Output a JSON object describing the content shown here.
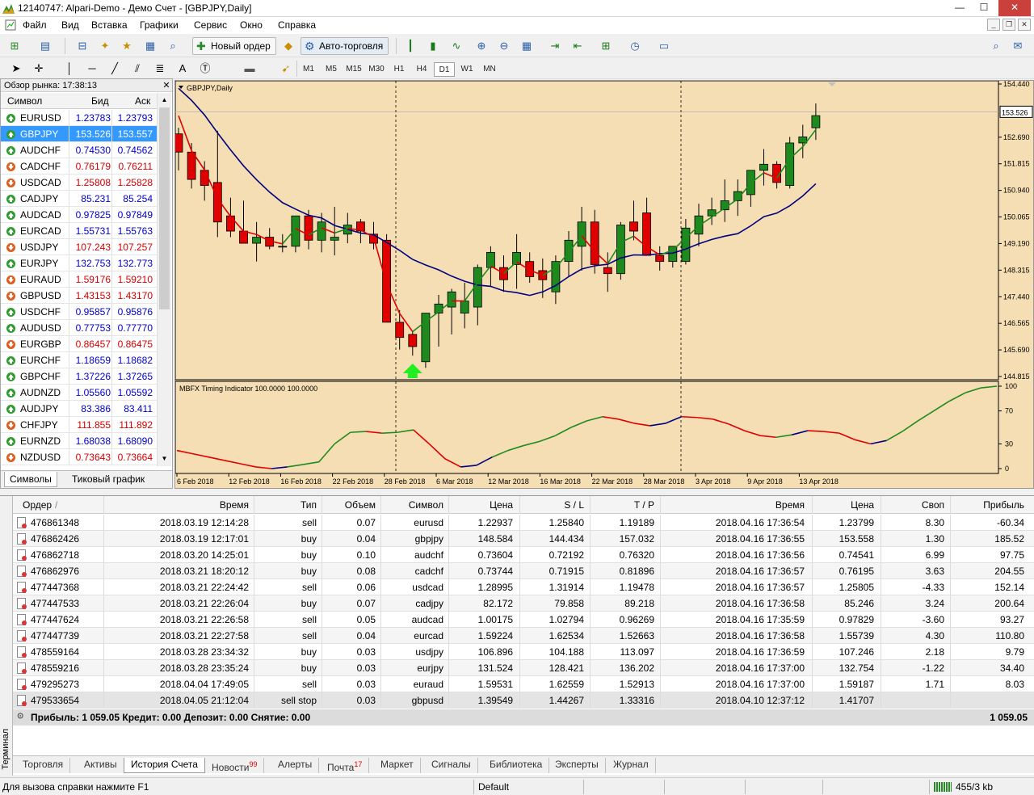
{
  "window": {
    "title": "12140747: Alpari-Demo - Демо Счет - [GBPJPY,Daily]",
    "min": "—",
    "max": "☐",
    "close": "✕"
  },
  "menu": [
    "Файл",
    "Вид",
    "Вставка",
    "Графики",
    "Сервис",
    "Окно",
    "Справка"
  ],
  "toolbar": {
    "new_order": "Новый ордер",
    "auto_trading": "Авто-торговля"
  },
  "timeframes": [
    "M1",
    "M5",
    "M15",
    "M30",
    "H1",
    "H4",
    "D1",
    "W1",
    "MN"
  ],
  "market_watch": {
    "title": "Обзор рынка: 17:38:13",
    "col_symbol": "Символ",
    "col_bid": "Бид",
    "col_ask": "Аск",
    "rows": [
      {
        "sym": "EURUSD",
        "bid": "1.23783",
        "ask": "1.23793",
        "dir": "up",
        "color": "#0000c8"
      },
      {
        "sym": "GBPJPY",
        "bid": "153.526",
        "ask": "153.557",
        "dir": "up",
        "color": "#ffffff"
      },
      {
        "sym": "AUDCHF",
        "bid": "0.74530",
        "ask": "0.74562",
        "dir": "up",
        "color": "#0000c8"
      },
      {
        "sym": "CADCHF",
        "bid": "0.76179",
        "ask": "0.76211",
        "dir": "down",
        "color": "#d40000"
      },
      {
        "sym": "USDCAD",
        "bid": "1.25808",
        "ask": "1.25828",
        "dir": "down",
        "color": "#d40000"
      },
      {
        "sym": "CADJPY",
        "bid": "85.231",
        "ask": "85.254",
        "dir": "up",
        "color": "#0000c8"
      },
      {
        "sym": "AUDCAD",
        "bid": "0.97825",
        "ask": "0.97849",
        "dir": "up",
        "color": "#0000c8"
      },
      {
        "sym": "EURCAD",
        "bid": "1.55731",
        "ask": "1.55763",
        "dir": "up",
        "color": "#0000c8"
      },
      {
        "sym": "USDJPY",
        "bid": "107.243",
        "ask": "107.257",
        "dir": "down",
        "color": "#d40000"
      },
      {
        "sym": "EURJPY",
        "bid": "132.753",
        "ask": "132.773",
        "dir": "up",
        "color": "#0000c8"
      },
      {
        "sym": "EURAUD",
        "bid": "1.59176",
        "ask": "1.59210",
        "dir": "down",
        "color": "#d40000"
      },
      {
        "sym": "GBPUSD",
        "bid": "1.43153",
        "ask": "1.43170",
        "dir": "down",
        "color": "#d40000"
      },
      {
        "sym": "USDCHF",
        "bid": "0.95857",
        "ask": "0.95876",
        "dir": "up",
        "color": "#0000c8"
      },
      {
        "sym": "AUDUSD",
        "bid": "0.77753",
        "ask": "0.77770",
        "dir": "up",
        "color": "#0000c8"
      },
      {
        "sym": "EURGBP",
        "bid": "0.86457",
        "ask": "0.86475",
        "dir": "down",
        "color": "#d40000"
      },
      {
        "sym": "EURCHF",
        "bid": "1.18659",
        "ask": "1.18682",
        "dir": "up",
        "color": "#0000c8"
      },
      {
        "sym": "GBPCHF",
        "bid": "1.37226",
        "ask": "1.37265",
        "dir": "up",
        "color": "#0000c8"
      },
      {
        "sym": "AUDNZD",
        "bid": "1.05560",
        "ask": "1.05592",
        "dir": "up",
        "color": "#0000c8"
      },
      {
        "sym": "AUDJPY",
        "bid": "83.386",
        "ask": "83.411",
        "dir": "up",
        "color": "#0000c8"
      },
      {
        "sym": "CHFJPY",
        "bid": "111.855",
        "ask": "111.892",
        "dir": "down",
        "color": "#d40000"
      },
      {
        "sym": "EURNZD",
        "bid": "1.68038",
        "ask": "1.68090",
        "dir": "up",
        "color": "#0000c8"
      },
      {
        "sym": "NZDUSD",
        "bid": "0.73643",
        "ask": "0.73664",
        "dir": "down",
        "color": "#d40000"
      }
    ],
    "tabs": [
      "Символы",
      "Тиковый график"
    ]
  },
  "chart": {
    "label": "GBPJPY,Daily",
    "indicator": "MBFX Timing Indicator 100.0000 100.0000",
    "current_price": "153.526",
    "price_ticks": [
      "154.440",
      "153.526",
      "152.690",
      "151.815",
      "150.940",
      "150.065",
      "149.190",
      "148.315",
      "147.440",
      "146.565",
      "145.690",
      "144.815"
    ],
    "ind_ticks": [
      "100",
      "70",
      "30",
      "0"
    ],
    "dates": [
      "6 Feb 2018",
      "12 Feb 2018",
      "16 Feb 2018",
      "22 Feb 2018",
      "28 Feb 2018",
      "6 Mar 2018",
      "12 Mar 2018",
      "16 Mar 2018",
      "22 Mar 2018",
      "28 Mar 2018",
      "3 Apr 2018",
      "9 Apr 2018",
      "13 Apr 2018"
    ]
  },
  "chart_data": {
    "type": "candlestick",
    "symbol": "GBPJPY",
    "timeframe": "Daily",
    "ylim": [
      144.815,
      154.44
    ],
    "candles": [
      [
        152.8,
        153.0,
        151.6,
        152.2
      ],
      [
        152.2,
        152.5,
        151.0,
        151.3
      ],
      [
        151.6,
        151.9,
        150.6,
        151.1
      ],
      [
        151.2,
        152.9,
        149.4,
        149.9
      ],
      [
        150.1,
        150.7,
        149.4,
        149.6
      ],
      [
        149.6,
        150.6,
        149.2,
        149.2
      ],
      [
        149.2,
        149.9,
        148.6,
        149.4
      ],
      [
        149.4,
        149.7,
        149.0,
        149.1
      ],
      [
        149.1,
        149.5,
        148.9,
        149.1
      ],
      [
        149.1,
        150.1,
        148.9,
        150.1
      ],
      [
        150.1,
        150.3,
        149.0,
        149.3
      ],
      [
        149.3,
        150.2,
        148.9,
        149.9
      ],
      [
        149.3,
        150.4,
        148.8,
        149.4
      ],
      [
        149.5,
        150.2,
        149.2,
        149.8
      ],
      [
        149.9,
        150.0,
        149.2,
        149.6
      ],
      [
        149.5,
        149.9,
        149.0,
        149.2
      ],
      [
        149.3,
        149.5,
        146.6,
        146.6
      ],
      [
        146.6,
        147.0,
        145.7,
        146.1
      ],
      [
        146.2,
        146.3,
        145.5,
        145.8
      ],
      [
        145.3,
        146.8,
        145.1,
        146.9
      ],
      [
        146.9,
        147.5,
        145.8,
        147.2
      ],
      [
        147.1,
        147.7,
        146.2,
        147.6
      ],
      [
        146.9,
        147.9,
        146.4,
        147.3
      ],
      [
        147.1,
        148.5,
        146.5,
        148.4
      ],
      [
        148.4,
        149.1,
        147.8,
        148.9
      ],
      [
        148.4,
        148.8,
        147.6,
        148.0
      ],
      [
        148.5,
        149.5,
        147.7,
        148.9
      ],
      [
        148.6,
        148.9,
        147.9,
        148.1
      ],
      [
        148.3,
        148.7,
        147.4,
        148.0
      ],
      [
        147.6,
        148.8,
        147.2,
        148.6
      ],
      [
        148.6,
        149.6,
        148.1,
        149.3
      ],
      [
        149.1,
        150.4,
        148.3,
        149.9
      ],
      [
        149.9,
        150.3,
        148.2,
        148.5
      ],
      [
        148.4,
        148.9,
        147.6,
        148.2
      ],
      [
        148.2,
        149.9,
        148.0,
        149.8
      ],
      [
        149.9,
        150.6,
        149.3,
        149.6
      ],
      [
        150.2,
        150.7,
        148.8,
        148.8
      ],
      [
        148.8,
        149.1,
        148.3,
        148.6
      ],
      [
        148.6,
        149.1,
        148.4,
        149.1
      ],
      [
        148.6,
        150.0,
        148.5,
        149.7
      ],
      [
        149.5,
        150.5,
        149.1,
        150.1
      ],
      [
        150.1,
        150.7,
        149.8,
        150.3
      ],
      [
        150.3,
        151.3,
        149.9,
        150.6
      ],
      [
        150.6,
        151.3,
        150.1,
        150.9
      ],
      [
        150.8,
        151.6,
        150.4,
        151.6
      ],
      [
        151.6,
        152.3,
        151.1,
        151.8
      ],
      [
        151.8,
        151.9,
        151.0,
        151.2
      ],
      [
        151.1,
        152.7,
        151.0,
        152.5
      ],
      [
        152.5,
        153.1,
        152.0,
        152.7
      ],
      [
        153.0,
        153.8,
        152.6,
        153.4
      ]
    ],
    "ma_fast_red_green": "trailing fast moving average",
    "ma_slow": "navy moving average",
    "indicator": {
      "name": "MBFX Timing Indicator",
      "ylim": [
        0,
        100
      ],
      "values": [
        22,
        18,
        14,
        10,
        6,
        2,
        0,
        2,
        5,
        8,
        30,
        44,
        45,
        43,
        44,
        47,
        30,
        12,
        2,
        4,
        14,
        22,
        28,
        33,
        40,
        50,
        58,
        63,
        60,
        55,
        52,
        55,
        63,
        62,
        60,
        54,
        46,
        40,
        38,
        41,
        46,
        45,
        43,
        35,
        30,
        34,
        45,
        58,
        70,
        82,
        92,
        98,
        100
      ]
    }
  },
  "terminal": {
    "side_label": "Терминал",
    "columns": [
      "Ордер",
      "Время",
      "Тип",
      "Объем",
      "Символ",
      "Цена",
      "S / L",
      "T / P",
      "Время",
      "Цена",
      "Своп",
      "Прибыль"
    ],
    "rows": [
      [
        "476861348",
        "2018.03.19 12:14:28",
        "sell",
        "0.07",
        "eurusd",
        "1.22937",
        "1.25840",
        "1.19189",
        "2018.04.16 17:36:54",
        "1.23799",
        "8.30",
        "-60.34"
      ],
      [
        "476862426",
        "2018.03.19 12:17:01",
        "buy",
        "0.04",
        "gbpjpy",
        "148.584",
        "144.434",
        "157.032",
        "2018.04.16 17:36:55",
        "153.558",
        "1.30",
        "185.52"
      ],
      [
        "476862718",
        "2018.03.20 14:25:01",
        "buy",
        "0.10",
        "audchf",
        "0.73604",
        "0.72192",
        "0.76320",
        "2018.04.16 17:36:56",
        "0.74541",
        "6.99",
        "97.75"
      ],
      [
        "476862976",
        "2018.03.21 18:20:12",
        "buy",
        "0.08",
        "cadchf",
        "0.73744",
        "0.71915",
        "0.81896",
        "2018.04.16 17:36:57",
        "0.76195",
        "3.63",
        "204.55"
      ],
      [
        "477447368",
        "2018.03.21 22:24:42",
        "sell",
        "0.06",
        "usdcad",
        "1.28995",
        "1.31914",
        "1.19478",
        "2018.04.16 17:36:57",
        "1.25805",
        "-4.33",
        "152.14"
      ],
      [
        "477447533",
        "2018.03.21 22:26:04",
        "buy",
        "0.07",
        "cadjpy",
        "82.172",
        "79.858",
        "89.218",
        "2018.04.16 17:36:58",
        "85.246",
        "3.24",
        "200.64"
      ],
      [
        "477447624",
        "2018.03.21 22:26:58",
        "sell",
        "0.05",
        "audcad",
        "1.00175",
        "1.02794",
        "0.96269",
        "2018.04.16 17:35:59",
        "0.97829",
        "-3.60",
        "93.27"
      ],
      [
        "477447739",
        "2018.03.21 22:27:58",
        "sell",
        "0.04",
        "eurcad",
        "1.59224",
        "1.62534",
        "1.52663",
        "2018.04.16 17:36:58",
        "1.55739",
        "4.30",
        "110.80"
      ],
      [
        "478559164",
        "2018.03.28 23:34:32",
        "buy",
        "0.03",
        "usdjpy",
        "106.896",
        "104.188",
        "113.097",
        "2018.04.16 17:36:59",
        "107.246",
        "2.18",
        "9.79"
      ],
      [
        "478559216",
        "2018.03.28 23:35:24",
        "buy",
        "0.03",
        "eurjpy",
        "131.524",
        "128.421",
        "136.202",
        "2018.04.16 17:37:00",
        "132.754",
        "-1.22",
        "34.40"
      ],
      [
        "479295273",
        "2018.04.04 17:49:05",
        "sell",
        "0.03",
        "euraud",
        "1.59531",
        "1.62559",
        "1.52913",
        "2018.04.16 17:37:00",
        "1.59187",
        "1.71",
        "8.03"
      ],
      [
        "479533654",
        "2018.04.05 21:12:04",
        "sell stop",
        "0.03",
        "gbpusd",
        "1.39549",
        "1.44267",
        "1.33316",
        "2018.04.10 12:37:12",
        "1.41707",
        "",
        ""
      ]
    ],
    "summary": "Прибыль: 1 059.05  Кредит: 0.00  Депозит: 0.00  Снятие: 0.00",
    "summary_total": "1 059.05",
    "tabs": [
      {
        "t": "Торговля"
      },
      {
        "t": "Активы"
      },
      {
        "t": "История Счета"
      },
      {
        "t": "Новости",
        "n": "99"
      },
      {
        "t": "Алерты"
      },
      {
        "t": "Почта",
        "n": "17"
      },
      {
        "t": "Маркет"
      },
      {
        "t": "Сигналы"
      },
      {
        "t": "Библиотека"
      },
      {
        "t": "Эксперты"
      },
      {
        "t": "Журнал"
      }
    ]
  },
  "status": {
    "help": "Для вызова справки нажмите F1",
    "profile": "Default",
    "traffic": "455/3 kb"
  },
  "colors": {
    "chart_bg": "#f5deb3",
    "bull": "#1e8a1e",
    "bear": "#e00000",
    "ma_slow": "#000080",
    "selection": "#3399ff"
  }
}
